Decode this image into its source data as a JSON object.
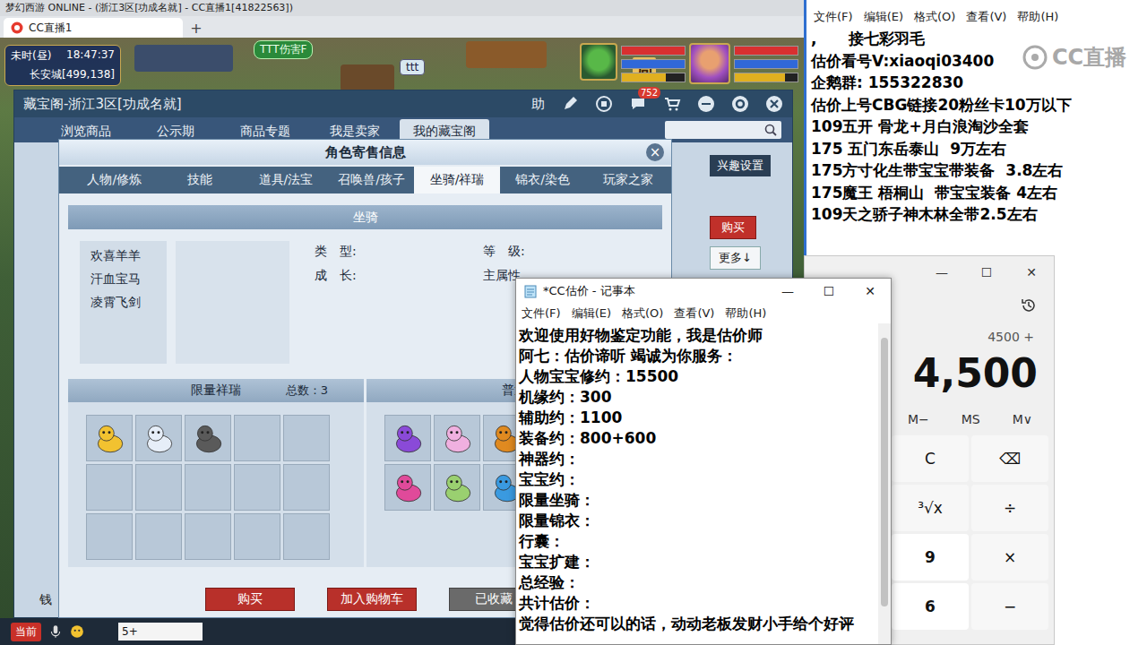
{
  "game": {
    "title": "梦幻西游 ONLINE - (浙江3区[功成名就] - CC直播1[41822563])",
    "browser_tabs": [
      {
        "label": "CC直播1",
        "selected": true
      }
    ],
    "new_tab": "+",
    "hud": {
      "period": "未时(昼)",
      "clock": "18:47:37",
      "location": "长安城[499,138]"
    },
    "scene_labels": [
      {
        "text": "TTT伤害F",
        "kind": "title"
      },
      {
        "text": "ttt",
        "kind": "name"
      },
      {
        "text": "局",
        "kind": "sign"
      }
    ],
    "pet_bars": [
      {
        "level": 1,
        "color": "#d83030"
      },
      {
        "level": 1,
        "color": "#3068d8"
      },
      {
        "level": 0.7,
        "color": "#e0b020"
      }
    ],
    "player_bars": [
      {
        "level": 1,
        "color": "#d83030"
      },
      {
        "level": 1,
        "color": "#3068d8"
      },
      {
        "level": 0.8,
        "color": "#e0b020"
      }
    ],
    "bottom_bar": {
      "channel": "当前",
      "input": "5+"
    }
  },
  "cbg": {
    "title": "藏宝阁-浙江3区[功成名就]",
    "help": "助",
    "badge": "752",
    "tabs": [
      {
        "label": "浏览商品",
        "selected": false
      },
      {
        "label": "公示期",
        "selected": false
      },
      {
        "label": "商品专题",
        "selected": false
      },
      {
        "label": "我是卖家",
        "selected": false
      },
      {
        "label": "我的藏宝阁",
        "selected": true
      }
    ],
    "interest_button": "兴趣设置",
    "buy_button": "购买",
    "more_button": "更多↓",
    "money_label": "钱"
  },
  "dialog": {
    "title": "角色寄售信息",
    "close": "×",
    "tabs": [
      {
        "label": "人物/修炼",
        "selected": false
      },
      {
        "label": "技能",
        "selected": false
      },
      {
        "label": "道具/法宝",
        "selected": false
      },
      {
        "label": "召唤兽/孩子",
        "selected": false
      },
      {
        "label": "坐骑/祥瑞",
        "selected": true
      },
      {
        "label": "锦衣/染色",
        "selected": false
      },
      {
        "label": "玩家之家",
        "selected": false
      }
    ],
    "section": "坐骑",
    "mounts": [
      {
        "name": "欢喜羊羊",
        "selected": false
      },
      {
        "name": "汗血宝马",
        "selected": false
      },
      {
        "name": "凌霄飞剑",
        "selected": false
      }
    ],
    "fields": [
      "类　型:",
      "等　级:",
      "成　长:",
      "主属性"
    ],
    "limited": {
      "title": "限量祥瑞",
      "count": "总数：3",
      "slots": [
        {
          "filled": true,
          "color": "#f2c230"
        },
        {
          "filled": true,
          "color": "#e6eef8"
        },
        {
          "filled": true,
          "color": "#5a5a5a"
        },
        {
          "filled": false,
          "color": "#000000"
        },
        {
          "filled": false,
          "color": "#000000"
        },
        {
          "filled": false,
          "color": "#000000"
        },
        {
          "filled": false,
          "color": "#000000"
        },
        {
          "filled": false,
          "color": "#000000"
        },
        {
          "filled": false,
          "color": "#000000"
        },
        {
          "filled": false,
          "color": "#000000"
        },
        {
          "filled": false,
          "color": "#000000"
        },
        {
          "filled": false,
          "color": "#000000"
        },
        {
          "filled": false,
          "color": "#000000"
        },
        {
          "filled": false,
          "color": "#000000"
        },
        {
          "filled": false,
          "color": "#000000"
        }
      ]
    },
    "normal": {
      "title": "普通",
      "slots": [
        {
          "filled": true,
          "color": "#8a4ad8"
        },
        {
          "filled": true,
          "color": "#f0b0e0"
        },
        {
          "filled": true,
          "color": "#e08a20"
        },
        {
          "filled": false,
          "color": "#000000"
        },
        {
          "filled": false,
          "color": "#000000"
        },
        {
          "filled": true,
          "color": "#e04a9a"
        },
        {
          "filled": true,
          "color": "#9ad070"
        },
        {
          "filled": true,
          "color": "#3a9ae0"
        },
        {
          "filled": false,
          "color": "#000000"
        },
        {
          "filled": false,
          "color": "#000000"
        }
      ]
    },
    "buttons": [
      {
        "label": "购买",
        "kind": "primary"
      },
      {
        "label": "加入购物车",
        "kind": "primary"
      },
      {
        "label": "已收藏",
        "kind": "muted"
      }
    ]
  },
  "top_notepad": {
    "menu": [
      "文件(F)",
      "编辑(E)",
      "格式(O)",
      "查看(V)",
      "帮助(H)"
    ],
    "lines": [
      ",      接七彩羽毛",
      "估价看号V:xiaoqi03400",
      "企鹅群: 155322830",
      "估价上号CBG链接20粉丝卡10万以下",
      "109五开 骨龙+月白浪淘沙全套",
      "175 五门东岳泰山  9万左右",
      "175方寸化生带宝宝带装备  3.8左右",
      "175魔王 梧桐山  带宝宝装备 4左右",
      "109天之骄子神木林全带2.5左右"
    ],
    "watermark": "CC直播"
  },
  "calculator": {
    "controls": [
      "—",
      "☐",
      "✕"
    ],
    "expression": "4500 +",
    "display": "4,500",
    "memory": [
      "M−",
      "MS",
      "M∨"
    ],
    "keys": [
      {
        "label": "C",
        "kind": "op"
      },
      {
        "label": "⌫",
        "kind": "op"
      },
      {
        "label": "³√x",
        "kind": "op"
      },
      {
        "label": "÷",
        "kind": "op"
      },
      {
        "label": "9",
        "kind": "digit"
      },
      {
        "label": "×",
        "kind": "op"
      },
      {
        "label": "6",
        "kind": "digit"
      },
      {
        "label": "−",
        "kind": "op"
      }
    ]
  },
  "estimate_notepad": {
    "title": "*CC估价 - 记事本",
    "controls": [
      "—",
      "☐",
      "✕"
    ],
    "menu": [
      "文件(F)",
      "编辑(E)",
      "格式(O)",
      "查看(V)",
      "帮助(H)"
    ],
    "lines": [
      "欢迎使用好物鉴定功能，我是估价师",
      "阿七：估价谛听 竭诚为你服务：",
      "人物宝宝修约：15500",
      "机缘约：300",
      "辅助约：1100",
      "装备约：800+600",
      "神器约：",
      "宝宝约：",
      "限量坐骑：",
      "限量锦衣：",
      "行囊：",
      "宝宝扩建：",
      "总经验：",
      "共计估价：",
      "觉得估价还可以的话，动动老板发财小手给个好评"
    ]
  }
}
